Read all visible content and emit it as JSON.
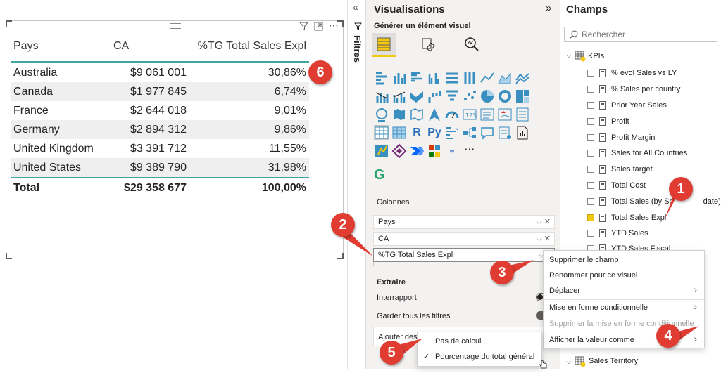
{
  "table": {
    "headers": [
      "Pays",
      "CA",
      "%TG Total Sales Expl"
    ],
    "rows": [
      [
        "Australia",
        "$9 061 001",
        "30,86%"
      ],
      [
        "Canada",
        "$1 977 845",
        "6,74%"
      ],
      [
        "France",
        "$2 644 018",
        "9,01%"
      ],
      [
        "Germany",
        "$2 894 312",
        "9,86%"
      ],
      [
        "United Kingdom",
        "$3 391 712",
        "11,55%"
      ],
      [
        "United States",
        "$9 389 790",
        "31,98%"
      ]
    ],
    "total": [
      "Total",
      "$29 358 677",
      "100,00%"
    ]
  },
  "visual_header": {
    "filter_icon": "filter-icon",
    "focus_icon": "focus-mode-icon",
    "more": "⋯"
  },
  "filters": {
    "label": "Filtres",
    "collapse": "«"
  },
  "visualisations": {
    "title": "Visualisations",
    "expand": "»",
    "build_label": "Générer un élément visuel",
    "gallery_extra": {
      "r": "R",
      "py": "Py",
      "w": "w",
      "more": "⋯",
      "g": "G"
    },
    "colonnes_label": "Colonnes",
    "wells": [
      {
        "name": "Pays"
      },
      {
        "name": "CA"
      },
      {
        "name": "%TG Total Sales Expl"
      }
    ],
    "extraire_label": "Extraire",
    "interrapport_label": "Interrapport",
    "garder_label": "Garder tous les filtres",
    "ajouter_label": "Ajouter des"
  },
  "champs": {
    "title": "Champs",
    "search_placeholder": "Rechercher",
    "table_kpis": "KPIs",
    "fields": [
      {
        "name": "% evol Sales vs LY",
        "checked": false
      },
      {
        "name": "% Sales per country",
        "checked": false
      },
      {
        "name": "Prior Year Sales",
        "checked": false
      },
      {
        "name": "Profit",
        "checked": false
      },
      {
        "name": "Profit Margin",
        "checked": false
      },
      {
        "name": "Sales for All Countries",
        "checked": false
      },
      {
        "name": "Sales target",
        "checked": false
      },
      {
        "name": "Total Cost",
        "checked": false
      },
      {
        "name": "Total Sales (by Sh",
        "suffix": "date)",
        "checked": false
      },
      {
        "name": "Total Sales Expl",
        "checked": true
      },
      {
        "name": "YTD Sales",
        "checked": false
      },
      {
        "name": "YTD Sales Fiscal",
        "checked": false
      }
    ],
    "table_sales_territory": "Sales Territory"
  },
  "context_menu": {
    "items": [
      {
        "label": "Supprimer le champ",
        "disabled": false
      },
      {
        "label": "Renommer pour ce visuel",
        "disabled": false
      },
      {
        "label": "Déplacer",
        "disabled": false,
        "submenu": true
      },
      {
        "label": "Mise en forme conditionnelle",
        "disabled": false,
        "submenu": true
      },
      {
        "label": "Supprimer la mise en forme conditionnelle",
        "disabled": true
      },
      {
        "label": "Afficher la valeur comme",
        "disabled": false,
        "submenu": true
      }
    ]
  },
  "submenu": {
    "items": [
      {
        "label": "Pas de calcul",
        "checked": false
      },
      {
        "label": "Pourcentage du total général",
        "checked": true
      }
    ],
    "check": "✓"
  },
  "callouts": [
    "1",
    "2",
    "3",
    "4",
    "5",
    "6"
  ],
  "colors": {
    "callout": "#e03c31",
    "accent": "#f2c811",
    "teal": "#41a4a4"
  }
}
